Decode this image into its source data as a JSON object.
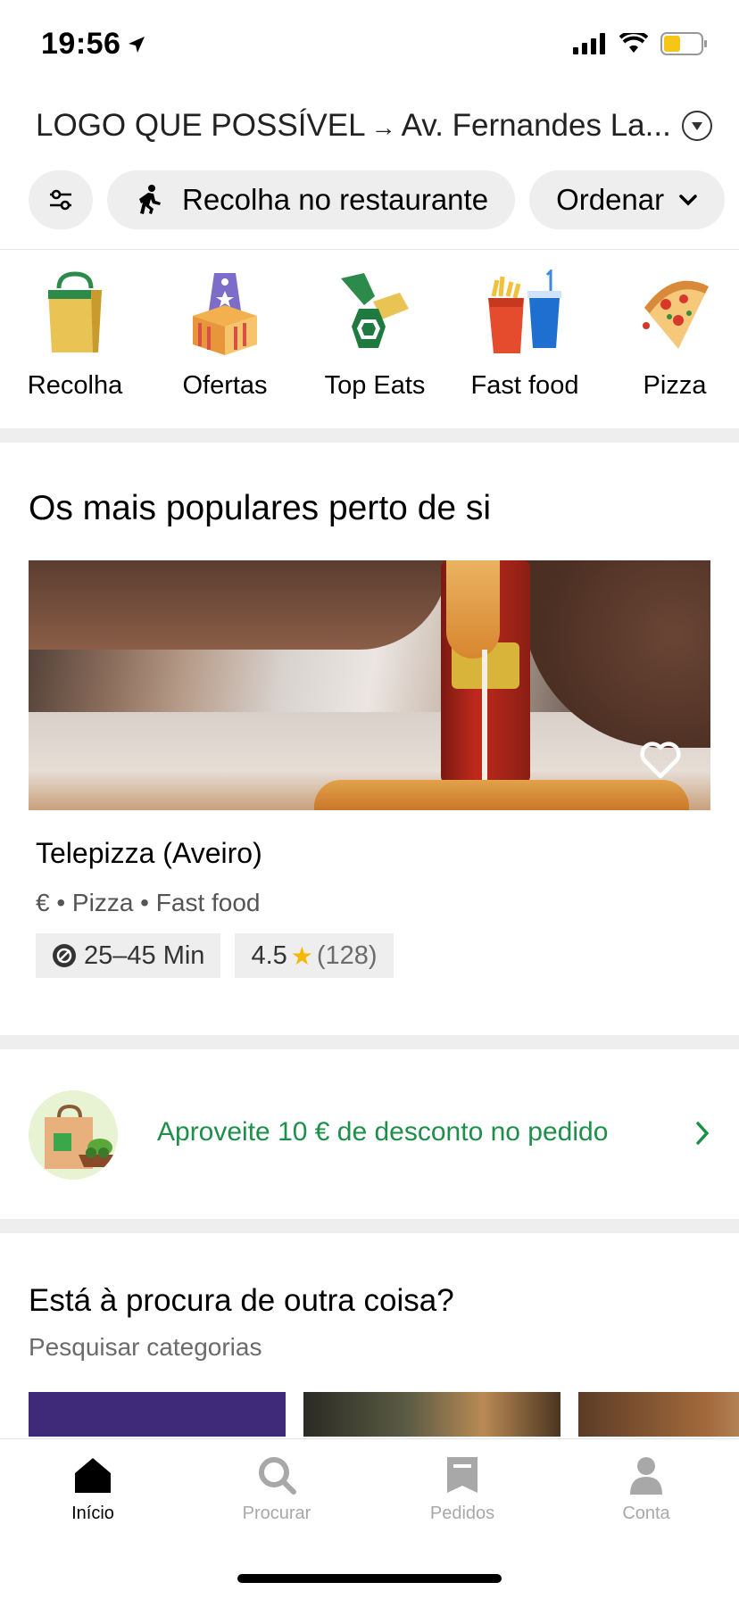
{
  "status_bar": {
    "time": "19:56"
  },
  "address": {
    "when": "LOGO QUE POSSÍVEL",
    "arrow": "→",
    "destination": "Av. Fernandes La..."
  },
  "filters": {
    "pickup_label": "Recolha no restaurante",
    "sort_label": "Ordenar"
  },
  "categories": [
    {
      "label": "Recolha",
      "icon": "pickup-bag-icon"
    },
    {
      "label": "Ofertas",
      "icon": "offers-icon"
    },
    {
      "label": "Top Eats",
      "icon": "top-eats-icon"
    },
    {
      "label": "Fast food",
      "icon": "fast-food-icon"
    },
    {
      "label": "Pizza",
      "icon": "pizza-icon"
    }
  ],
  "popular": {
    "title": "Os mais populares perto de si",
    "restaurant": {
      "name": "Telepizza (Aveiro)",
      "meta": "€ • Pizza • Fast food",
      "delivery_time": "25–45 Min",
      "rating": "4.5",
      "rating_count": "(128)"
    }
  },
  "promo": {
    "text": "Aproveite 10 € de desconto no pedido"
  },
  "lookfor": {
    "title": "Está à procura de outra coisa?",
    "subtitle": "Pesquisar categorias"
  },
  "tabs": [
    {
      "label": "Início",
      "icon": "home-icon",
      "active": true
    },
    {
      "label": "Procurar",
      "icon": "search-icon",
      "active": false
    },
    {
      "label": "Pedidos",
      "icon": "receipt-icon",
      "active": false
    },
    {
      "label": "Conta",
      "icon": "account-icon",
      "active": false
    }
  ],
  "colors": {
    "promo_green": "#1e8f4a",
    "star": "#f5b800",
    "chip_bg": "#eeeeee"
  }
}
